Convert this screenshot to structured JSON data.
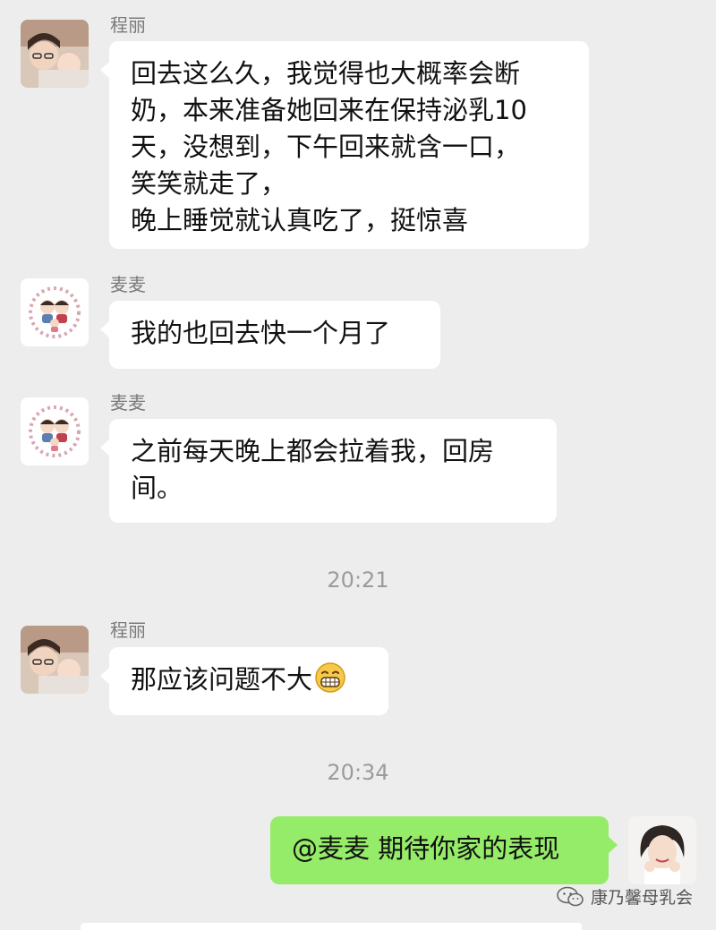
{
  "messages": [
    {
      "sender": "程丽",
      "lines": [
        "回去这么久，我觉得也大概率会断",
        "奶，本来准备她回来在保持泌乳10",
        "天，没想到，下午回来就含一口，",
        "笑笑就走了，",
        "晚上睡觉就认真吃了，挺惊喜"
      ]
    },
    {
      "sender": "麦麦",
      "lines": [
        "我的也回去快一个月了"
      ]
    },
    {
      "sender": "麦麦",
      "lines": [
        "之前每天晚上都会拉着我，回房",
        "间。"
      ]
    },
    {
      "time": "20:21"
    },
    {
      "sender": "程丽",
      "lines": [
        "那应该问题不大"
      ],
      "emoji": "grin-emoji"
    },
    {
      "time": "20:34"
    },
    {
      "self": true,
      "lines": [
        "@麦麦 期待你家的表现"
      ]
    }
  ],
  "watermark": {
    "icon": "wechat-icon",
    "text": "康乃馨母乳会"
  },
  "colors": {
    "background": "#ededed",
    "incoming_bubble": "#ffffff",
    "outgoing_bubble": "#95ec69"
  }
}
